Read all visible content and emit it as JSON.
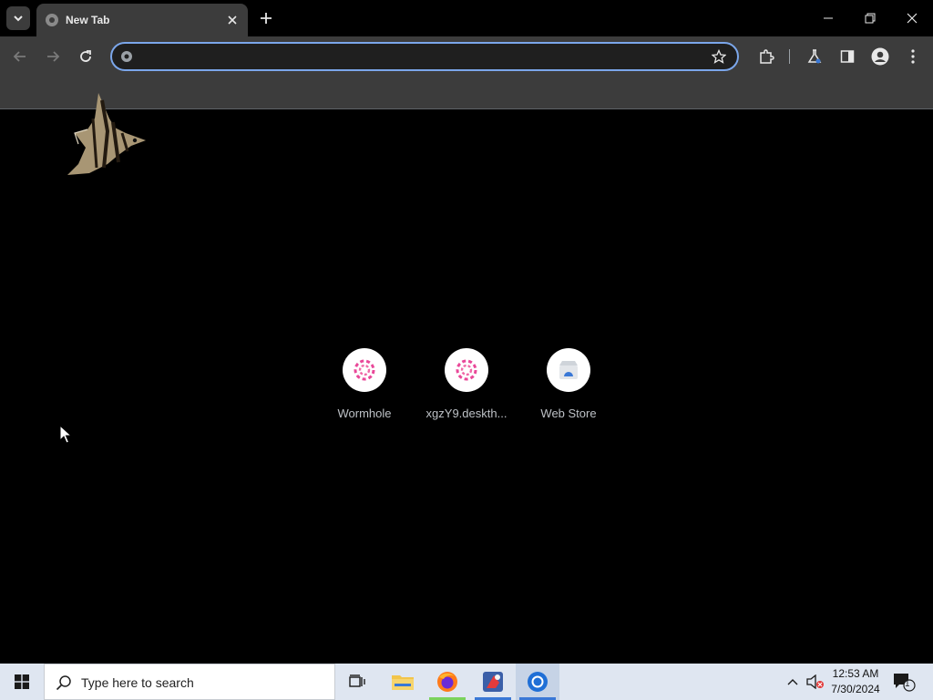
{
  "browser": {
    "tab": {
      "title": "New Tab"
    },
    "omnibox": {
      "value": "",
      "placeholder": ""
    }
  },
  "new_tab_page": {
    "shortcuts": [
      {
        "label": "Wormhole",
        "icon": "wormhole-icon"
      },
      {
        "label": "xgzY9.deskth...",
        "icon": "wormhole-icon"
      },
      {
        "label": "Web Store",
        "icon": "web-store-icon"
      }
    ]
  },
  "taskbar": {
    "search_placeholder": "Type here to search",
    "apps": [
      "task-view",
      "file-explorer",
      "firefox",
      "app",
      "chrome"
    ],
    "notification_count": "1"
  },
  "clock": {
    "time": "12:53 AM",
    "date": "7/30/2024"
  },
  "colors": {
    "page_bg": "#000000",
    "chrome_frame": "#3c3c3c",
    "omnibox_focus": "#7ba6ea",
    "taskbar_bg": "#dfe6f1",
    "accent_green": "#7bd35c",
    "accent_blue": "#3a78d6"
  }
}
